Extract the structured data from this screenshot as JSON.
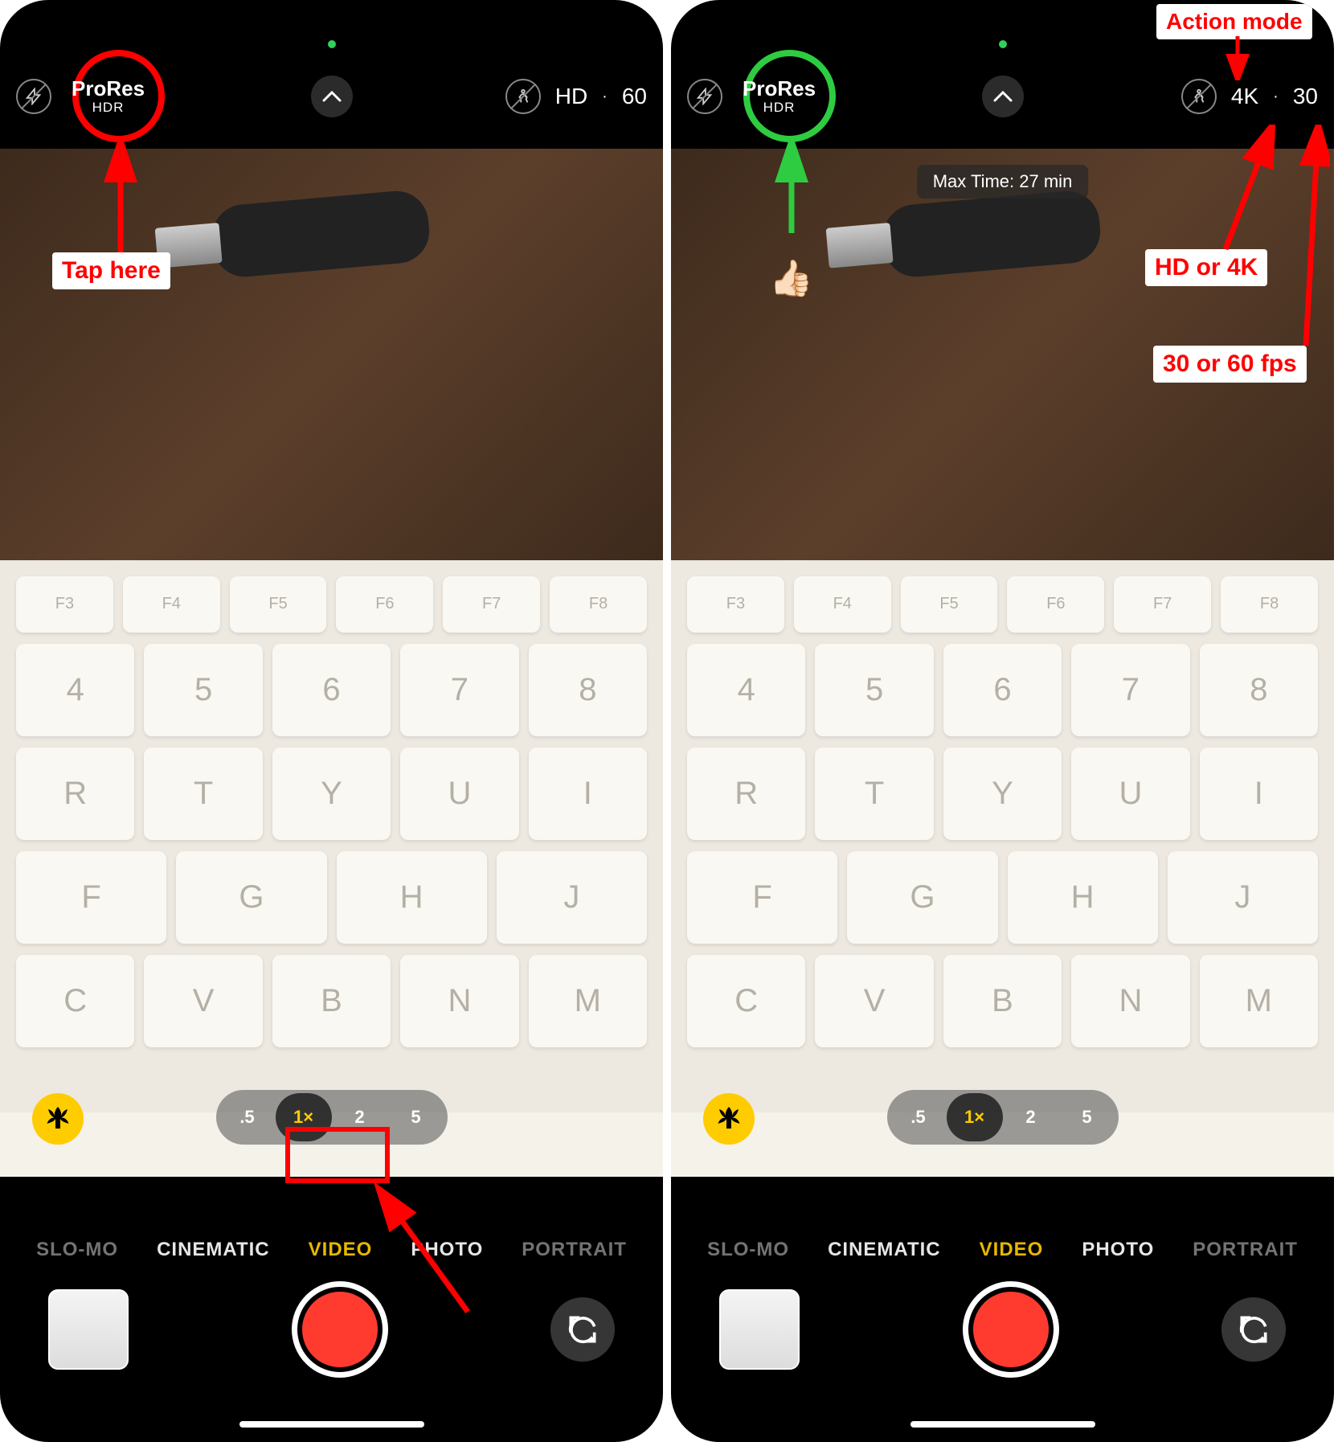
{
  "left": {
    "prores": "ProRes",
    "hdr": "HDR",
    "resolution": "HD",
    "separator": "·",
    "fps": "60",
    "zoom": {
      "z05": ".5",
      "z1": "1×",
      "z2": "2",
      "z5": "5"
    },
    "modes": {
      "slomo": "SLO-MO",
      "cinematic": "CINEMATIC",
      "video": "VIDEO",
      "photo": "PHOTO",
      "portrait": "PORTRAIT"
    },
    "anno_taphere": "Tap here"
  },
  "right": {
    "prores": "ProRes",
    "hdr": "HDR",
    "resolution": "4K",
    "separator": "·",
    "fps": "30",
    "maxtime": "Max Time: 27 min",
    "zoom": {
      "z05": ".5",
      "z1": "1×",
      "z2": "2",
      "z5": "5"
    },
    "modes": {
      "slomo": "SLO-MO",
      "cinematic": "CINEMATIC",
      "video": "VIDEO",
      "photo": "PHOTO",
      "portrait": "PORTRAIT"
    },
    "anno_actionmode": "Action mode",
    "anno_hdor4k": "HD or 4K",
    "anno_30or60": "30 or 60 fps",
    "thumbs_up": "👍🏻"
  }
}
